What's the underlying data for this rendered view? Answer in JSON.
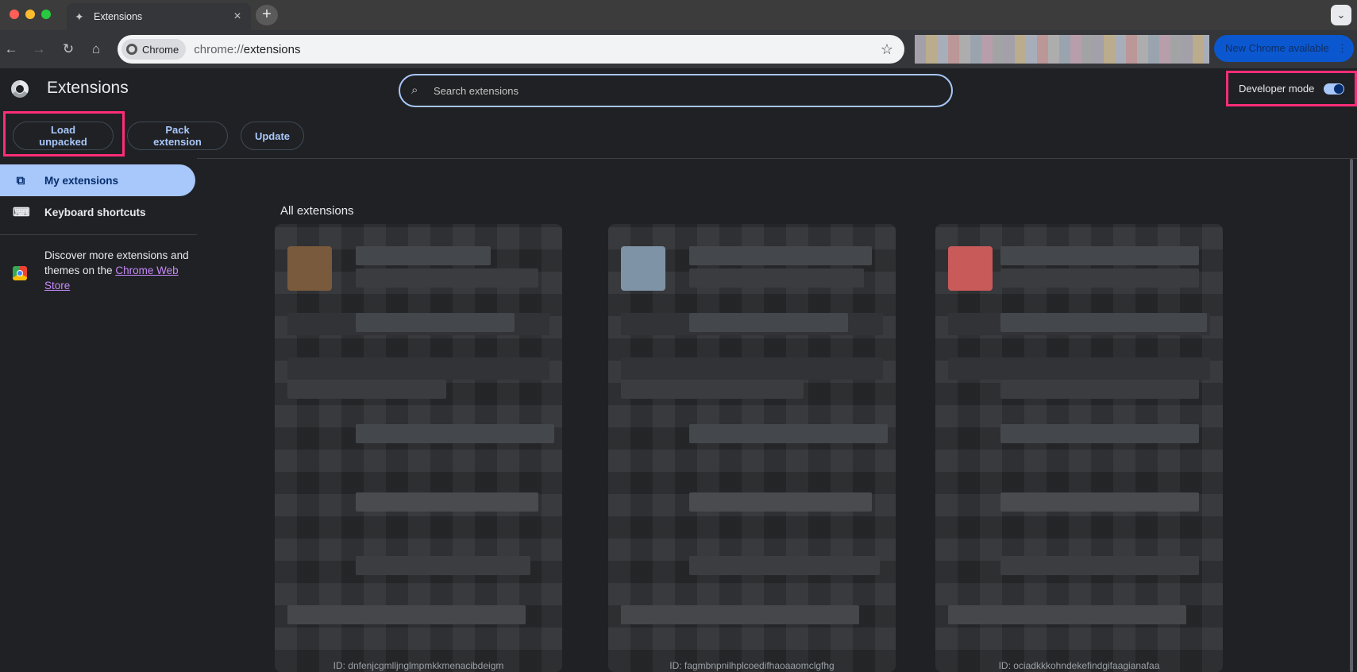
{
  "window": {
    "tab_title": "Extensions",
    "tab_icon": "puzzle-icon",
    "new_tab_symbol": "+",
    "tab_search_symbol": "⌄"
  },
  "toolbar": {
    "site_chip": "Chrome",
    "url_scheme": "chrome://",
    "url_path": "extensions",
    "update_pill": "New Chrome available",
    "update_menu": "⋮"
  },
  "header": {
    "title": "Extensions",
    "search_placeholder": "Search extensions",
    "developer_mode_label": "Developer mode",
    "developer_mode_on": true
  },
  "actions": {
    "load_unpacked": "Load unpacked",
    "pack_extension": "Pack extension",
    "update": "Update"
  },
  "sidebar": {
    "items": [
      {
        "label": "My extensions",
        "icon": "puzzle-outline-icon",
        "active": true
      },
      {
        "label": "Keyboard shortcuts",
        "icon": "keyboard-icon",
        "active": false
      }
    ],
    "discover_prefix": "Discover more extensions and themes on the",
    "discover_link": "Chrome Web Store"
  },
  "main": {
    "section_title": "All extensions",
    "cards": [
      {
        "id_text": "ID: dnfenjcgmlljnglmpmkkmenacibdeigm",
        "icon_color": "#7a5a3c"
      },
      {
        "id_text": "ID: fagmbnpnilhplcoedifhaoaaomclgfhg",
        "icon_color": "#7f93a6"
      },
      {
        "id_text": "ID: ociadkkkohndekefindgifaagianafaa",
        "icon_color": "#c95a5a"
      }
    ]
  },
  "colors": {
    "accent": "#a8c7fa",
    "highlight": "#ff2d78",
    "background": "#202124"
  }
}
